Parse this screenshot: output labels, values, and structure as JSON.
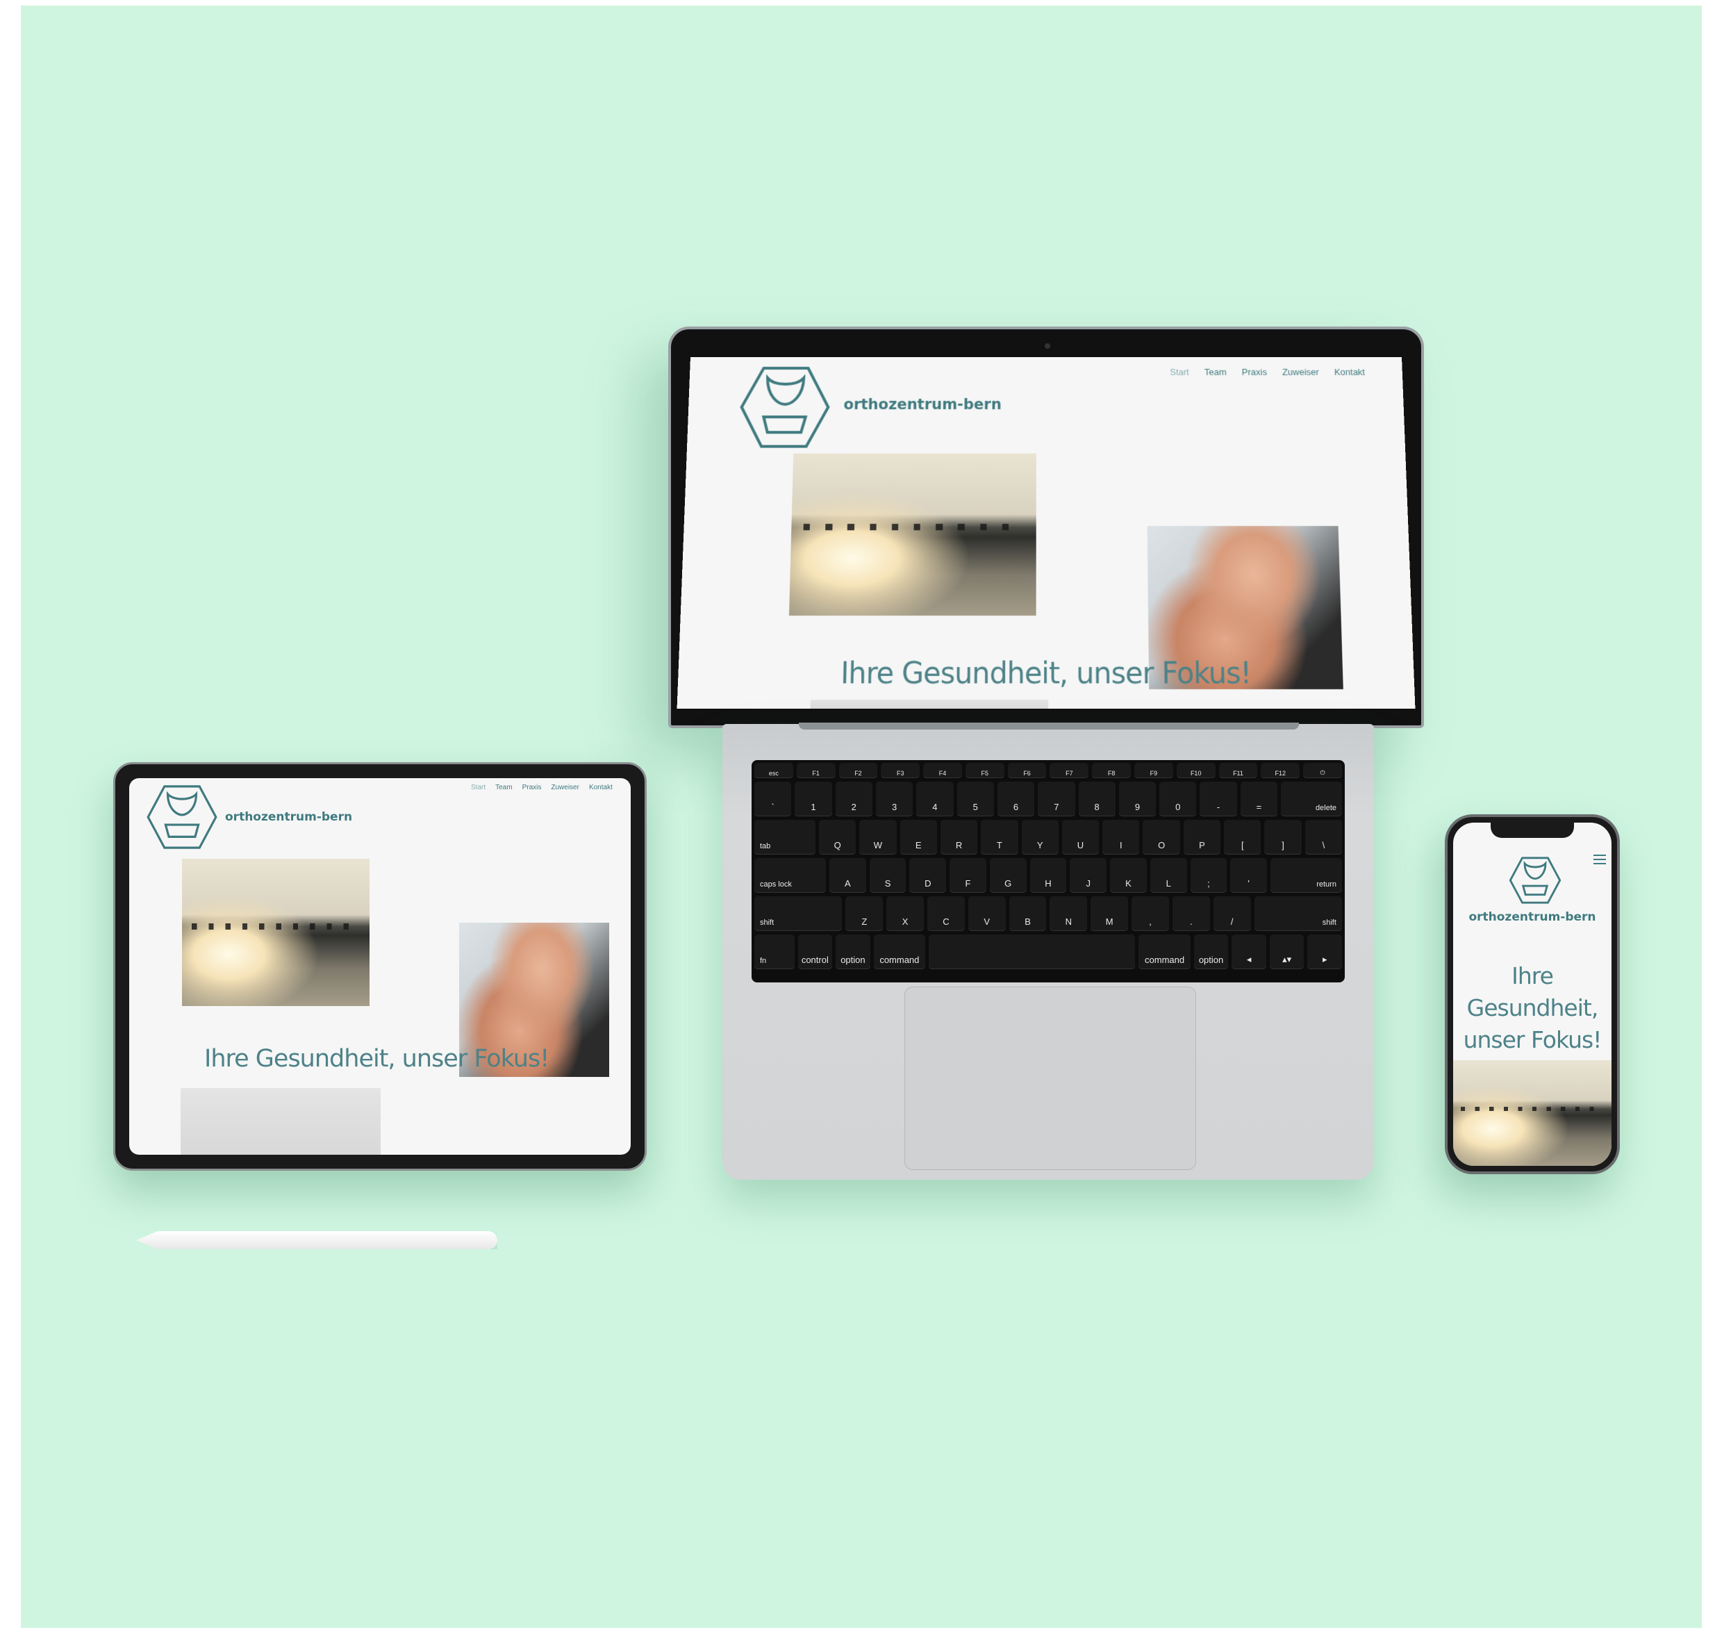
{
  "site": {
    "brand": "orthozentrum-bern",
    "nav": [
      "Start",
      "Team",
      "Praxis",
      "Zuweiser",
      "Kontakt"
    ],
    "headline": "Ihre Gesundheit, unser Fokus!",
    "headline_lines": [
      "Ihre",
      "Gesundheit,",
      "unser Fokus!"
    ],
    "accent_color": "#3f7a7f"
  },
  "keyboard": {
    "fn_row": [
      "esc",
      "F1",
      "F2",
      "F3",
      "F4",
      "F5",
      "F6",
      "F7",
      "F8",
      "F9",
      "F10",
      "F11",
      "F12",
      "⏻"
    ],
    "number_row": [
      "`",
      "1",
      "2",
      "3",
      "4",
      "5",
      "6",
      "7",
      "8",
      "9",
      "0",
      "-",
      "=",
      "delete"
    ],
    "q_row": [
      "tab",
      "Q",
      "W",
      "E",
      "R",
      "T",
      "Y",
      "U",
      "I",
      "O",
      "P",
      "[",
      "]",
      "\\"
    ],
    "a_row": [
      "caps lock",
      "A",
      "S",
      "D",
      "F",
      "G",
      "H",
      "J",
      "K",
      "L",
      ";",
      "'",
      "return"
    ],
    "z_row": [
      "shift",
      "Z",
      "X",
      "C",
      "V",
      "B",
      "N",
      "M",
      ",",
      ".",
      "/",
      "shift"
    ],
    "bottom_row": [
      "fn",
      "control",
      "option",
      "command",
      "",
      "command",
      "option",
      "◂",
      "▴▾",
      "▸"
    ]
  },
  "phone": {
    "menu_icon": "hamburger-menu-icon"
  }
}
